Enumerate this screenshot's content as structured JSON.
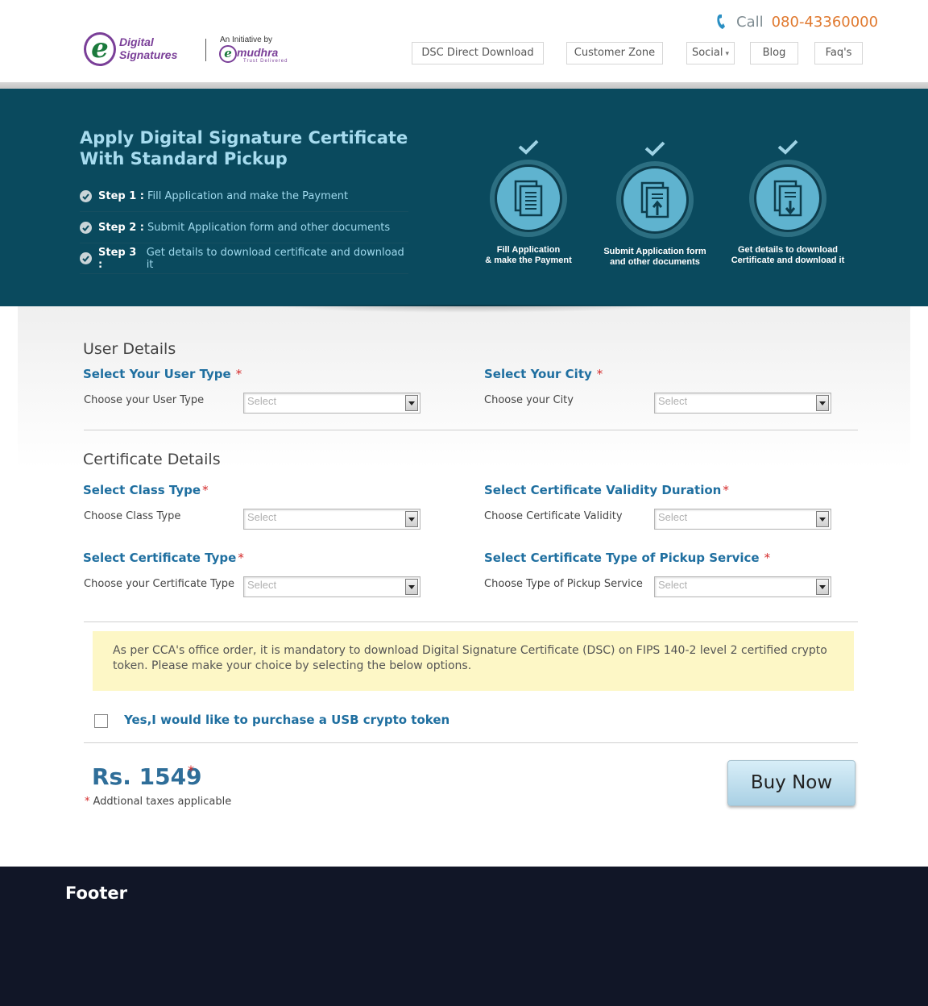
{
  "header": {
    "logo_line1": "Digital",
    "logo_line2": "Signatures",
    "logo_letter": "e",
    "initiative_text": "An Initiative by",
    "partner_letter": "e",
    "partner_name": "mudhra",
    "partner_tagline": "Trust Delivered",
    "call_label": "Call",
    "call_number": "080-43360000",
    "nav": [
      {
        "label": "DSC Direct Download"
      },
      {
        "label": "Customer Zone"
      },
      {
        "label": "Social",
        "caret": "▾"
      },
      {
        "label": "Blog"
      },
      {
        "label": "Faq's"
      }
    ]
  },
  "hero": {
    "title": "Apply Digital Signature Certificate With Standard Pickup",
    "steps": [
      {
        "label": "Step 1 :",
        "text": "Fill Application and make the Payment"
      },
      {
        "label": "Step 2 :",
        "text": "Submit Application form and other documents"
      },
      {
        "label": "Step 3 :",
        "text": "Get details to download certificate and download it"
      }
    ],
    "icons": [
      {
        "caption_line1": "Fill Application",
        "caption_line2": "& make the Payment"
      },
      {
        "caption_line1": "Submit Application form",
        "caption_line2": "and other documents"
      },
      {
        "caption_line1": "Get details to download",
        "caption_line2": "Certificate and download it"
      }
    ]
  },
  "user_details": {
    "section_title": "User Details",
    "user_type": {
      "title": "Select Your User Type",
      "label": "Choose your User Type",
      "value": "Select"
    },
    "city": {
      "title": "Select Your City",
      "label": "Choose your City",
      "value": "Select"
    }
  },
  "certificate_details": {
    "section_title": "Certificate Details",
    "class_type": {
      "title": "Select Class Type",
      "label": "Choose  Class Type",
      "value": "Select"
    },
    "validity": {
      "title": "Select Certificate Validity Duration",
      "label": "Choose Certificate Validity",
      "value": "Select"
    },
    "cert_type": {
      "title": "Select Certificate Type",
      "label": "Choose your Certificate Type",
      "value": "Select"
    },
    "pickup": {
      "title": "Select Certificate Type of Pickup Service",
      "label": "Choose Type of Pickup Service",
      "value": "Select"
    }
  },
  "required_mark": "*",
  "notice": "As per CCA's office order, it is mandatory to download Digital Signature Certificate (DSC) on FIPS 140-2 level 2 certified crypto token. Please make your choice by selecting the below options.",
  "token_option": {
    "label": "Yes,I would like to purchase a USB crypto token",
    "checked": false
  },
  "price": {
    "amount": "Rs. 1549",
    "note": "Addtional taxes applicable"
  },
  "buy_button": "Buy Now",
  "footer": {
    "title": "Footer"
  },
  "colors": {
    "hero_bg": "#0a4a5e",
    "accent_blue": "#1f6fa0",
    "phone_orange": "#e0792f",
    "required_red": "#d42a2a",
    "notice_bg": "#fdf7c6",
    "footer_bg": "#111627"
  },
  "icons": [
    "phone-icon",
    "check-circle-icon",
    "checkmark-icon",
    "document-icon",
    "document-upload-icon",
    "document-download-icon",
    "dropdown-arrow-icon"
  ]
}
